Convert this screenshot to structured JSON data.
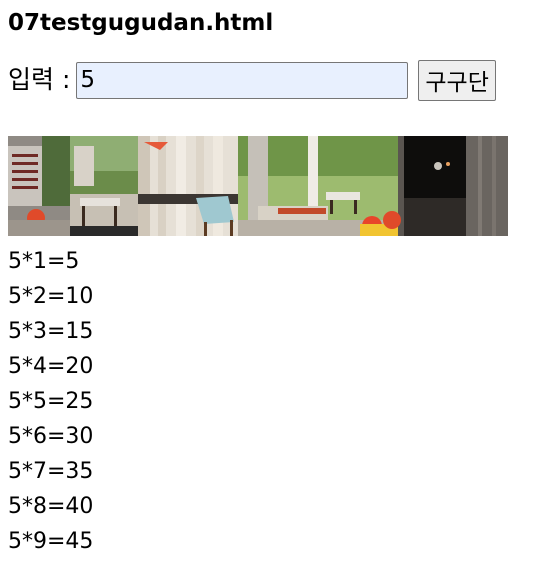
{
  "page": {
    "title": "07testgugudan.html"
  },
  "form": {
    "label": "입력 :",
    "input_value": "5",
    "button_label": "구구단"
  },
  "banner": {
    "description_icon": "patio-lounge-photo"
  },
  "results": [
    "5*1=5",
    "5*2=10",
    "5*3=15",
    "5*4=20",
    "5*5=25",
    "5*6=30",
    "5*7=35",
    "5*8=40",
    "5*9=45"
  ]
}
